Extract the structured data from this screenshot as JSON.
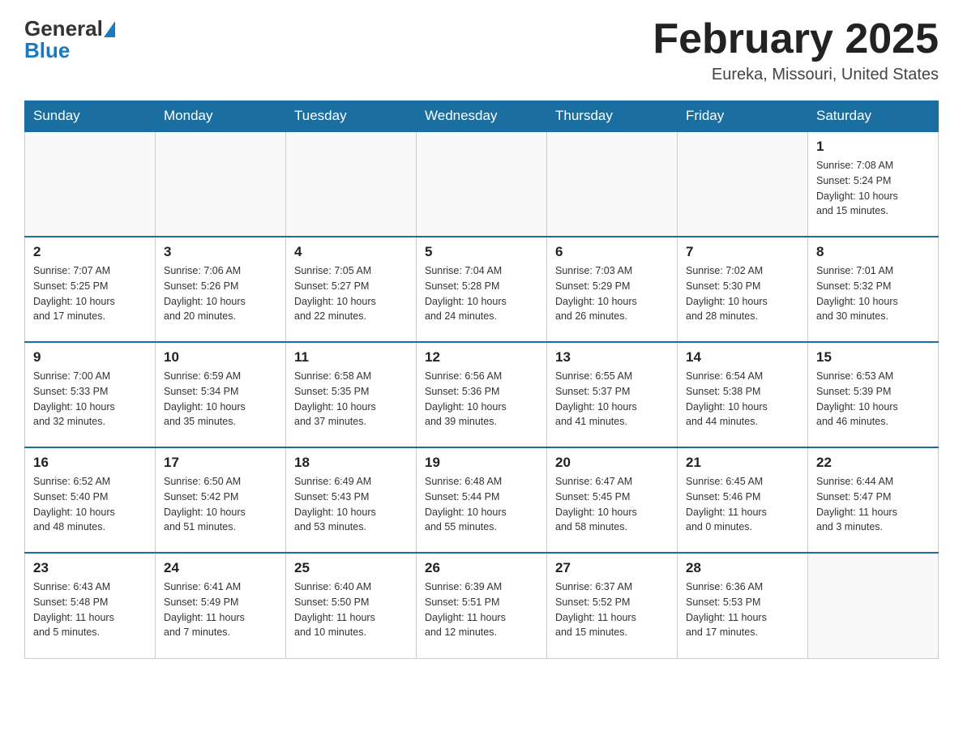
{
  "header": {
    "logo_text_general": "General",
    "logo_text_blue": "Blue",
    "month_title": "February 2025",
    "location": "Eureka, Missouri, United States"
  },
  "days_of_week": [
    "Sunday",
    "Monday",
    "Tuesday",
    "Wednesday",
    "Thursday",
    "Friday",
    "Saturday"
  ],
  "weeks": [
    [
      {
        "day": "",
        "info": ""
      },
      {
        "day": "",
        "info": ""
      },
      {
        "day": "",
        "info": ""
      },
      {
        "day": "",
        "info": ""
      },
      {
        "day": "",
        "info": ""
      },
      {
        "day": "",
        "info": ""
      },
      {
        "day": "1",
        "info": "Sunrise: 7:08 AM\nSunset: 5:24 PM\nDaylight: 10 hours\nand 15 minutes."
      }
    ],
    [
      {
        "day": "2",
        "info": "Sunrise: 7:07 AM\nSunset: 5:25 PM\nDaylight: 10 hours\nand 17 minutes."
      },
      {
        "day": "3",
        "info": "Sunrise: 7:06 AM\nSunset: 5:26 PM\nDaylight: 10 hours\nand 20 minutes."
      },
      {
        "day": "4",
        "info": "Sunrise: 7:05 AM\nSunset: 5:27 PM\nDaylight: 10 hours\nand 22 minutes."
      },
      {
        "day": "5",
        "info": "Sunrise: 7:04 AM\nSunset: 5:28 PM\nDaylight: 10 hours\nand 24 minutes."
      },
      {
        "day": "6",
        "info": "Sunrise: 7:03 AM\nSunset: 5:29 PM\nDaylight: 10 hours\nand 26 minutes."
      },
      {
        "day": "7",
        "info": "Sunrise: 7:02 AM\nSunset: 5:30 PM\nDaylight: 10 hours\nand 28 minutes."
      },
      {
        "day": "8",
        "info": "Sunrise: 7:01 AM\nSunset: 5:32 PM\nDaylight: 10 hours\nand 30 minutes."
      }
    ],
    [
      {
        "day": "9",
        "info": "Sunrise: 7:00 AM\nSunset: 5:33 PM\nDaylight: 10 hours\nand 32 minutes."
      },
      {
        "day": "10",
        "info": "Sunrise: 6:59 AM\nSunset: 5:34 PM\nDaylight: 10 hours\nand 35 minutes."
      },
      {
        "day": "11",
        "info": "Sunrise: 6:58 AM\nSunset: 5:35 PM\nDaylight: 10 hours\nand 37 minutes."
      },
      {
        "day": "12",
        "info": "Sunrise: 6:56 AM\nSunset: 5:36 PM\nDaylight: 10 hours\nand 39 minutes."
      },
      {
        "day": "13",
        "info": "Sunrise: 6:55 AM\nSunset: 5:37 PM\nDaylight: 10 hours\nand 41 minutes."
      },
      {
        "day": "14",
        "info": "Sunrise: 6:54 AM\nSunset: 5:38 PM\nDaylight: 10 hours\nand 44 minutes."
      },
      {
        "day": "15",
        "info": "Sunrise: 6:53 AM\nSunset: 5:39 PM\nDaylight: 10 hours\nand 46 minutes."
      }
    ],
    [
      {
        "day": "16",
        "info": "Sunrise: 6:52 AM\nSunset: 5:40 PM\nDaylight: 10 hours\nand 48 minutes."
      },
      {
        "day": "17",
        "info": "Sunrise: 6:50 AM\nSunset: 5:42 PM\nDaylight: 10 hours\nand 51 minutes."
      },
      {
        "day": "18",
        "info": "Sunrise: 6:49 AM\nSunset: 5:43 PM\nDaylight: 10 hours\nand 53 minutes."
      },
      {
        "day": "19",
        "info": "Sunrise: 6:48 AM\nSunset: 5:44 PM\nDaylight: 10 hours\nand 55 minutes."
      },
      {
        "day": "20",
        "info": "Sunrise: 6:47 AM\nSunset: 5:45 PM\nDaylight: 10 hours\nand 58 minutes."
      },
      {
        "day": "21",
        "info": "Sunrise: 6:45 AM\nSunset: 5:46 PM\nDaylight: 11 hours\nand 0 minutes."
      },
      {
        "day": "22",
        "info": "Sunrise: 6:44 AM\nSunset: 5:47 PM\nDaylight: 11 hours\nand 3 minutes."
      }
    ],
    [
      {
        "day": "23",
        "info": "Sunrise: 6:43 AM\nSunset: 5:48 PM\nDaylight: 11 hours\nand 5 minutes."
      },
      {
        "day": "24",
        "info": "Sunrise: 6:41 AM\nSunset: 5:49 PM\nDaylight: 11 hours\nand 7 minutes."
      },
      {
        "day": "25",
        "info": "Sunrise: 6:40 AM\nSunset: 5:50 PM\nDaylight: 11 hours\nand 10 minutes."
      },
      {
        "day": "26",
        "info": "Sunrise: 6:39 AM\nSunset: 5:51 PM\nDaylight: 11 hours\nand 12 minutes."
      },
      {
        "day": "27",
        "info": "Sunrise: 6:37 AM\nSunset: 5:52 PM\nDaylight: 11 hours\nand 15 minutes."
      },
      {
        "day": "28",
        "info": "Sunrise: 6:36 AM\nSunset: 5:53 PM\nDaylight: 11 hours\nand 17 minutes."
      },
      {
        "day": "",
        "info": ""
      }
    ]
  ]
}
